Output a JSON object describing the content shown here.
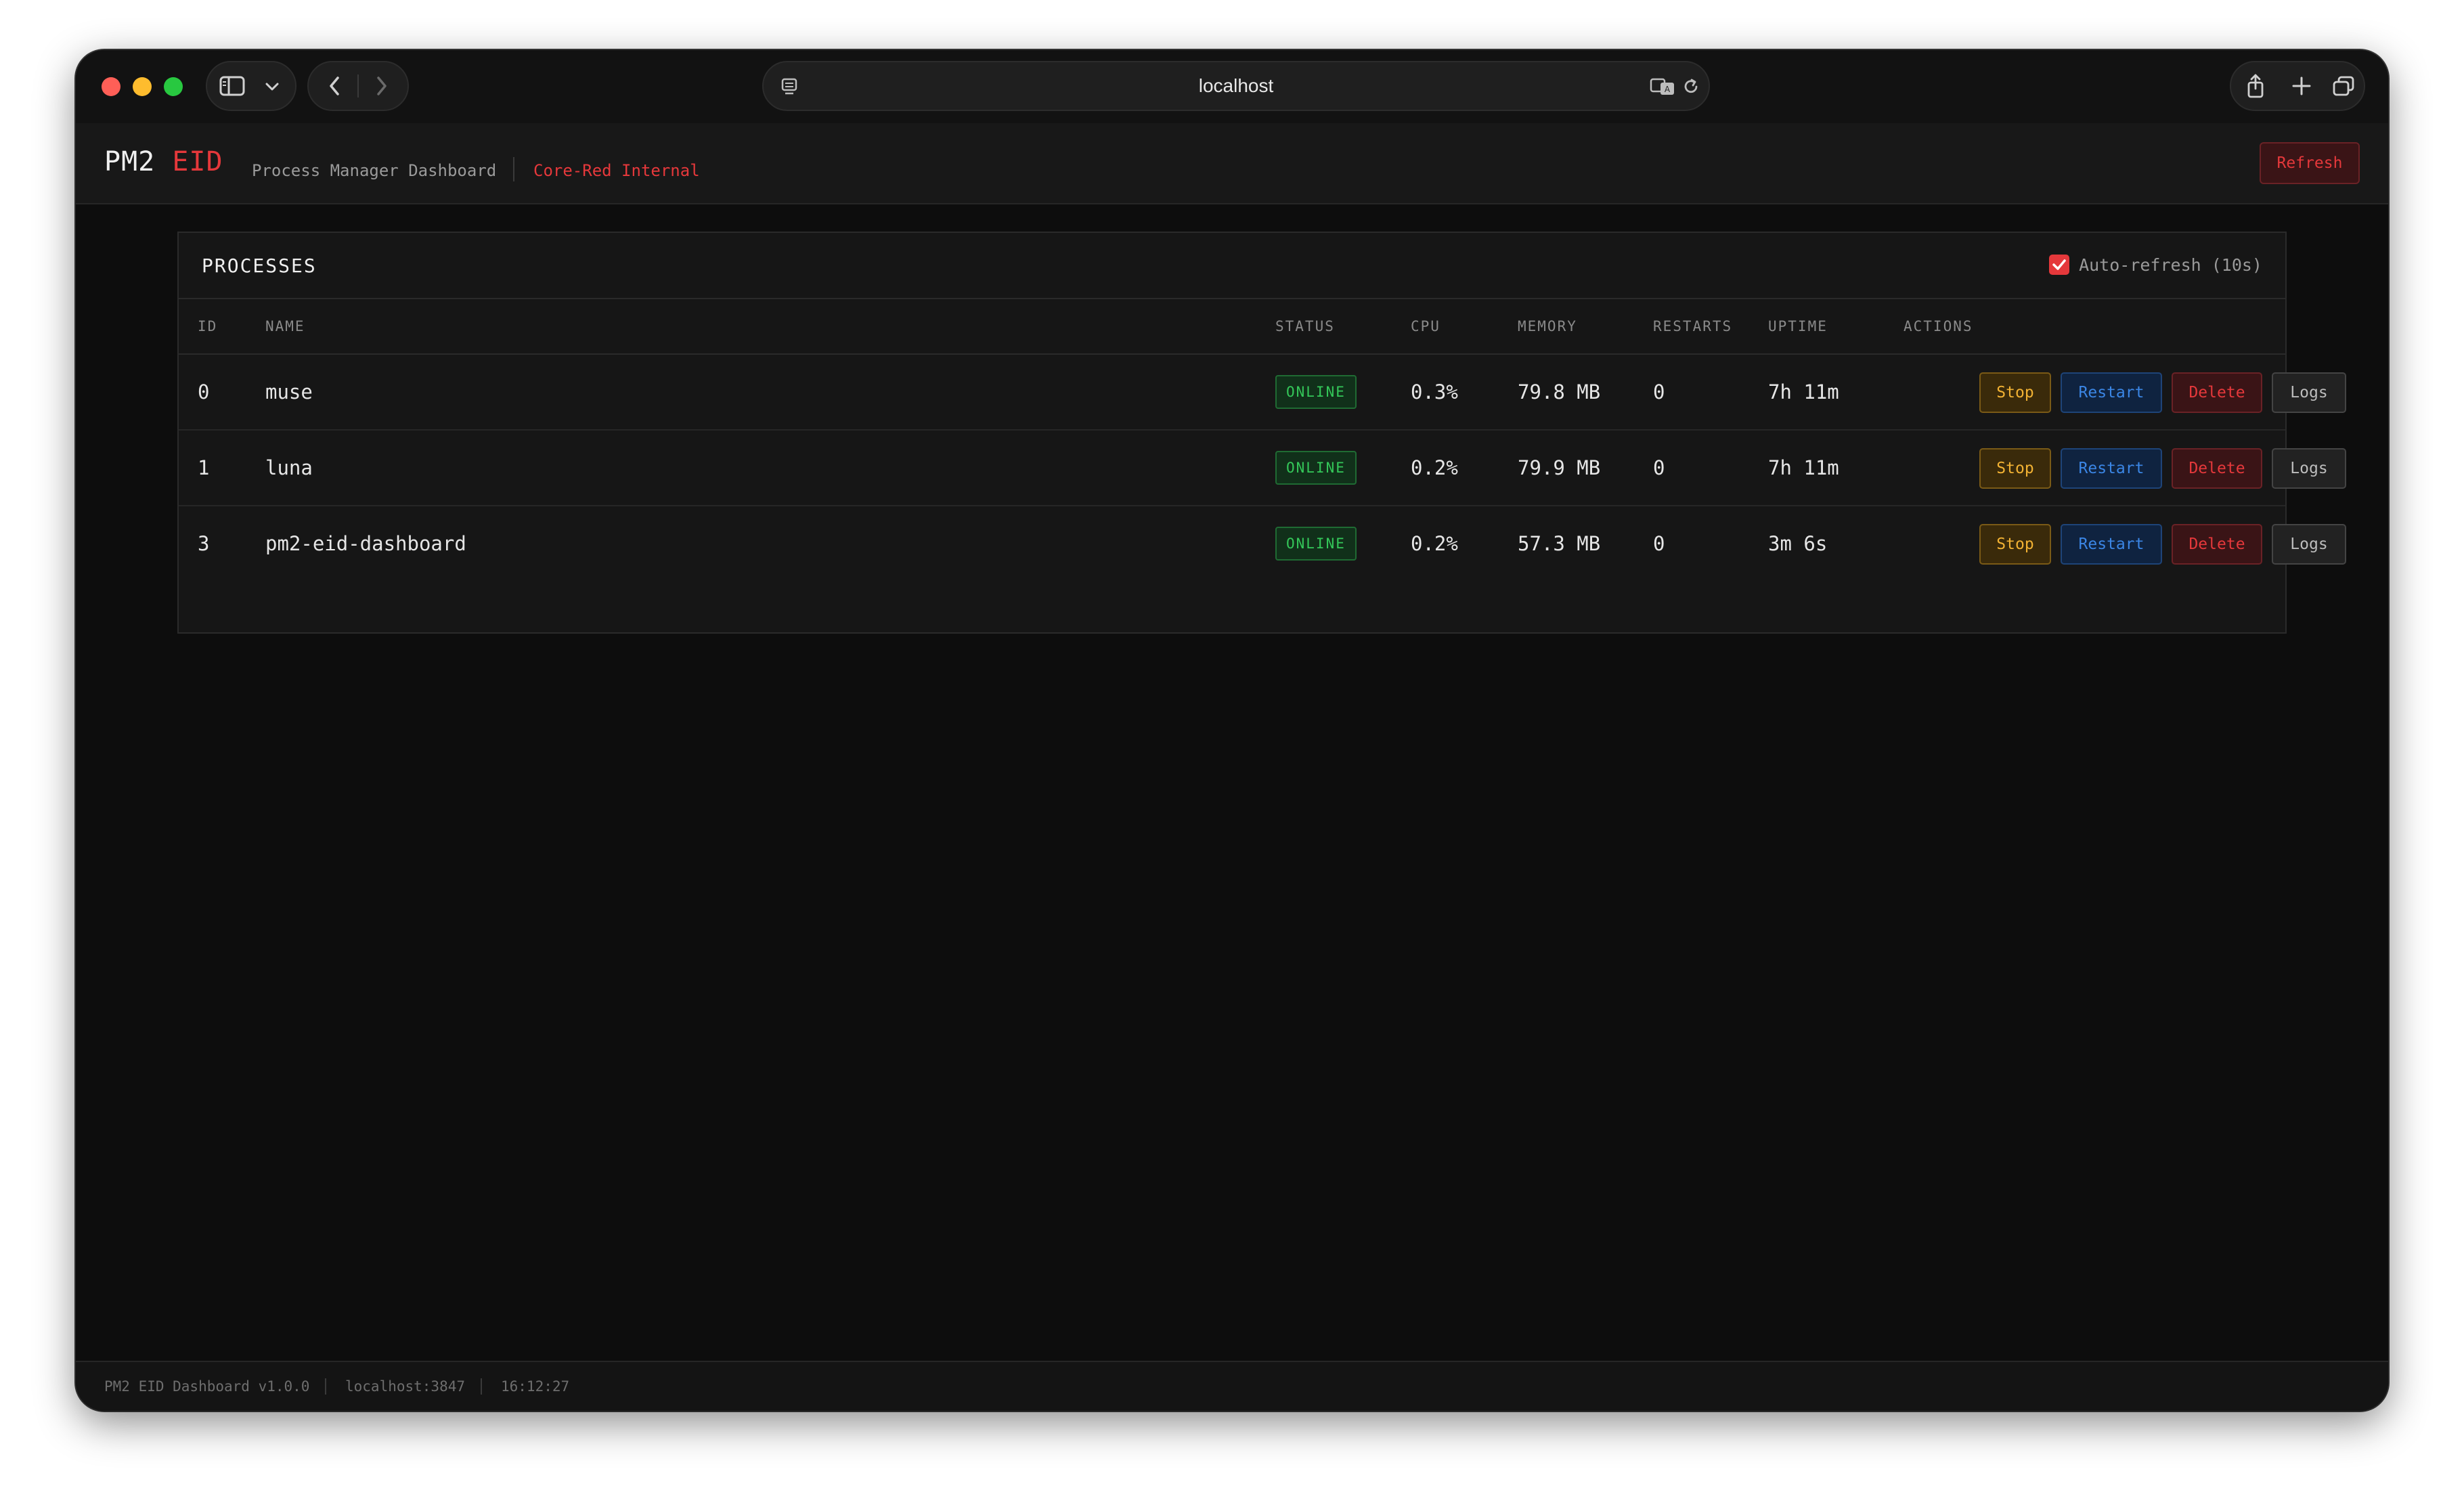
{
  "browser": {
    "url": "localhost"
  },
  "header": {
    "brand_main": "PM2",
    "brand_accent": "EID",
    "subtitle": "Process Manager Dashboard",
    "internal_label": "Core-Red Internal",
    "refresh_label": "Refresh"
  },
  "panel": {
    "title": "PROCESSES",
    "auto_refresh_label": "Auto-refresh (10s)",
    "auto_refresh_checked": true,
    "columns": [
      "ID",
      "NAME",
      "STATUS",
      "CPU",
      "MEMORY",
      "RESTARTS",
      "UPTIME",
      "ACTIONS"
    ],
    "rows": [
      {
        "id": "0",
        "name": "muse",
        "status": "ONLINE",
        "cpu": "0.3%",
        "memory": "79.8 MB",
        "restarts": "0",
        "uptime": "7h 11m"
      },
      {
        "id": "1",
        "name": "luna",
        "status": "ONLINE",
        "cpu": "0.2%",
        "memory": "79.9 MB",
        "restarts": "0",
        "uptime": "7h 11m"
      },
      {
        "id": "3",
        "name": "pm2-eid-dashboard",
        "status": "ONLINE",
        "cpu": "0.2%",
        "memory": "57.3 MB",
        "restarts": "0",
        "uptime": "3m 6s"
      }
    ],
    "actions": {
      "stop": "Stop",
      "restart": "Restart",
      "delete": "Delete",
      "logs": "Logs"
    }
  },
  "footer": {
    "version": "PM2 EID Dashboard v1.0.0",
    "host": "localhost:3847",
    "time": "16:12:27"
  },
  "colors": {
    "accent": "#e5383b",
    "online": "#34c759",
    "stop": "#f2b233",
    "restart": "#3b86e5",
    "background": "#0d0d0d"
  },
  "icons": [
    "sidebar-icon",
    "chevron-down-icon",
    "back-icon",
    "forward-icon",
    "page-icon",
    "translate-icon",
    "reload-icon",
    "share-icon",
    "new-tab-icon",
    "tabs-overview-icon",
    "check-icon"
  ]
}
